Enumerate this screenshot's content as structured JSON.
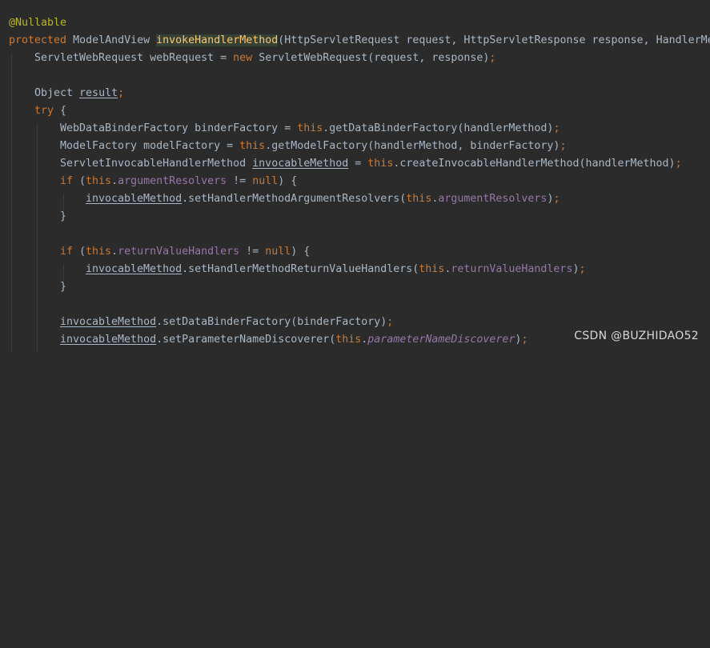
{
  "code": {
    "line_annotation": "@Nullable",
    "line_signature": {
      "modifier": "protected",
      "return_type": " ModelAndView ",
      "method_name": "invokeHandlerMethod",
      "params": "(HttpServletRequest request, HttpServletResponse response, HandlerMe"
    },
    "line_webrequest": {
      "p1": "ServletWebRequest webRequest = ",
      "kw_new": "new",
      "p2": " ServletWebRequest(request, response)",
      "semi": ";"
    },
    "line_object_result": {
      "p1": "Object ",
      "var": "result",
      "semi": ";"
    },
    "line_try": {
      "kw": "try",
      "p1": " {"
    },
    "line_binder": {
      "p1": "WebDataBinderFactory binderFactory = ",
      "kw": "this",
      "p2": ".getDataBinderFactory(handlerMethod)",
      "semi": ";"
    },
    "line_model": {
      "p1": "ModelFactory modelFactory = ",
      "kw": "this",
      "p2": ".getModelFactory(handlerMethod, binderFactory)",
      "semi": ";"
    },
    "line_invocable": {
      "p1": "ServletInvocableHandlerMethod ",
      "var": "invocableMethod",
      "p2": " = ",
      "kw": "this",
      "p3": ".createInvocableHandlerMethod(handlerMethod)",
      "semi": ";"
    },
    "line_if_arg": {
      "kw_if": "if",
      "p1": " (",
      "kw_this": "this",
      "p2": ".",
      "field": "argumentResolvers",
      "p3": " != ",
      "kw_null": "null",
      "p4": ") {"
    },
    "line_set_arg": {
      "var": "invocableMethod",
      "p1": ".setHandlerMethodArgumentResolvers(",
      "kw_this": "this",
      "p2": ".",
      "field": "argumentResolvers",
      "p3": ")",
      "semi": ";"
    },
    "line_close_1": "}",
    "line_if_ret": {
      "kw_if": "if",
      "p1": " (",
      "kw_this": "this",
      "p2": ".",
      "field": "returnValueHandlers",
      "p3": " != ",
      "kw_null": "null",
      "p4": ") {"
    },
    "line_set_ret": {
      "var": "invocableMethod",
      "p1": ".setHandlerMethodReturnValueHandlers(",
      "kw_this": "this",
      "p2": ".",
      "field": "returnValueHandlers",
      "p3": ")",
      "semi": ";"
    },
    "line_close_2": "}",
    "line_set_binder": {
      "var": "invocableMethod",
      "p1": ".setDataBinderFactory(binderFactory)",
      "semi": ";"
    },
    "line_set_param": {
      "var": "invocableMethod",
      "p1": ".setParameterNameDiscoverer(",
      "kw_this": "this",
      "p2": ".",
      "field": "parameterNameDiscoverer",
      "p3": ")",
      "semi": ";"
    }
  },
  "watermark": "CSDN @BUZHIDAO52",
  "colors": {
    "background": "#2b2b2b",
    "text": "#a9b7c6",
    "keyword": "#cc7832",
    "annotation": "#bbb529",
    "field": "#9876aa",
    "method_declaration": "#ffc66d"
  }
}
